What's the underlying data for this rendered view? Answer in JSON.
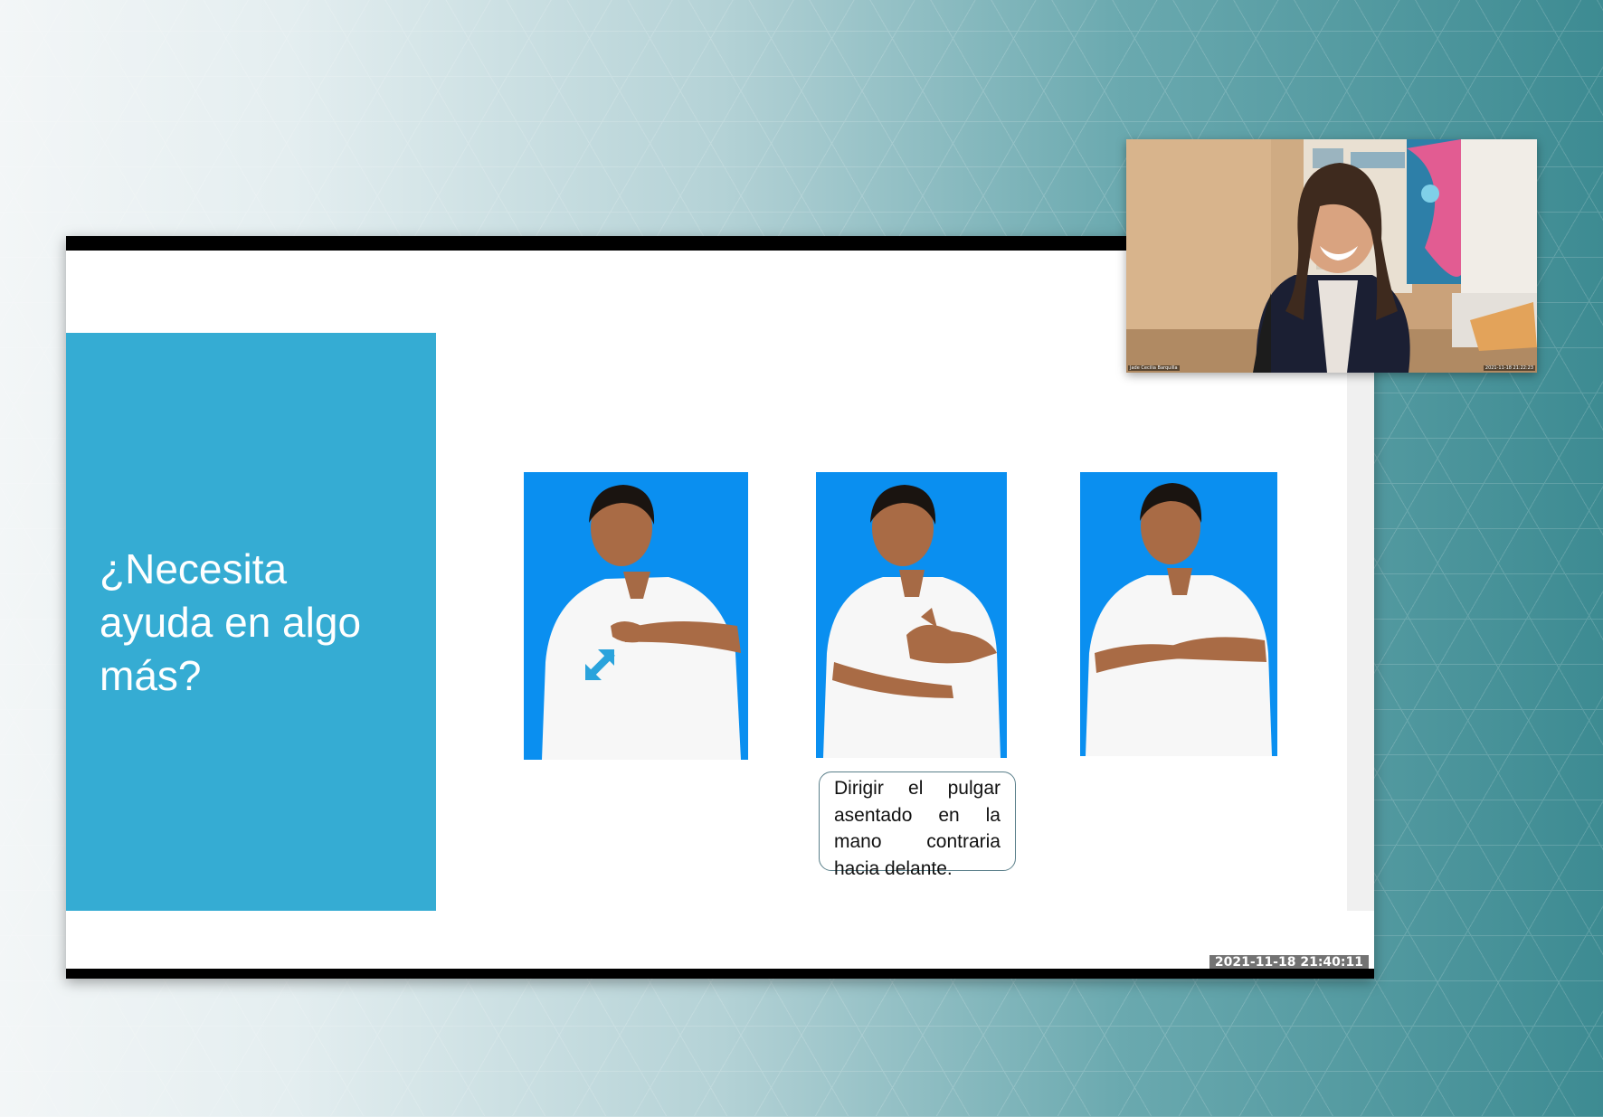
{
  "slide": {
    "title": "¿Necesita ayuda en algo más?",
    "caption": "Dirigir el pulgar asentado en la mano contraria hacia delante.",
    "timestamp": "2021-11-18  21:40:11",
    "accent_color": "#35acd3",
    "photo_background_color": "#0a8ff0",
    "movement_icon": "double-arrow-icon"
  },
  "webcam": {
    "name_label": "Jade Cecilia Barquilla",
    "timestamp": "2021-11-18  21:22:23"
  }
}
